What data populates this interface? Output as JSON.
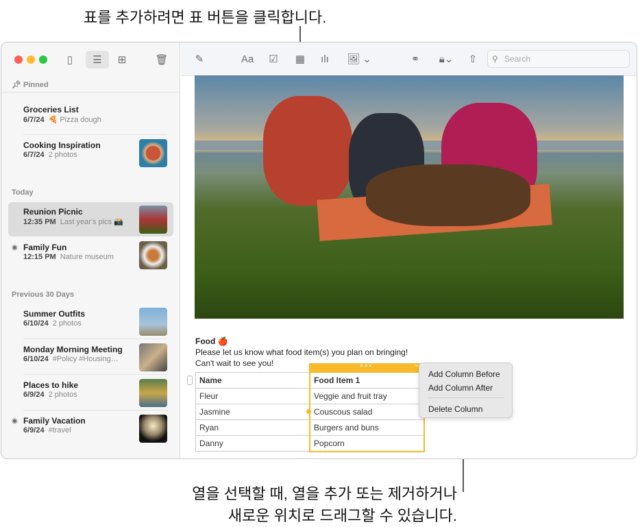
{
  "callouts": {
    "top": "표를 추가하려면 표 버튼을 클릭합니다.",
    "bottom_line1": "열을 선택할 때, 열을 추가 또는 제거하거나",
    "bottom_line2": "새로운 위치로 드래그할 수 있습니다."
  },
  "toolbar": {
    "search_placeholder": "Search",
    "format_label": "Aa"
  },
  "sidebar": {
    "sections": [
      {
        "label": "Pinned"
      },
      {
        "label": "Today"
      },
      {
        "label": "Previous 30 Days"
      }
    ],
    "items": [
      {
        "title": "Groceries List",
        "date": "6/7/24",
        "preview": "🍕 Pizza dough"
      },
      {
        "title": "Cooking Inspiration",
        "date": "6/7/24",
        "preview": "2 photos"
      },
      {
        "title": "Reunion Picnic",
        "date": "12:35 PM",
        "preview": "Last year's pics 📸",
        "selected": true
      },
      {
        "title": "Family Fun",
        "date": "12:15 PM",
        "preview": "Nature museum",
        "shared": true
      },
      {
        "title": "Summer Outfits",
        "date": "6/10/24",
        "preview": "2 photos"
      },
      {
        "title": "Monday Morning Meeting",
        "date": "6/10/24",
        "preview": "#Policy #Housing…"
      },
      {
        "title": "Places to hike",
        "date": "6/9/24",
        "preview": "2 photos"
      },
      {
        "title": "Family Vacation",
        "date": "6/9/24",
        "preview": "#travel",
        "shared": true
      }
    ]
  },
  "note": {
    "heading": "Food 🍎",
    "line1": "Please let us know what food item(s) you plan on bringing!",
    "line2": "Can't wait to see you!",
    "table": {
      "headers": [
        "Name",
        "Food Item 1"
      ],
      "rows": [
        [
          "Fleur",
          "Veggie and fruit tray"
        ],
        [
          "Jasmine",
          "Couscous salad"
        ],
        [
          "Ryan",
          "Burgers and buns"
        ],
        [
          "Danny",
          "Popcorn"
        ]
      ]
    }
  },
  "context_menu": {
    "items": [
      "Add Column Before",
      "Add Column After",
      "Delete Column"
    ]
  },
  "colors": {
    "accent": "#f8b92a",
    "selected_row": "#dcdcdc"
  }
}
